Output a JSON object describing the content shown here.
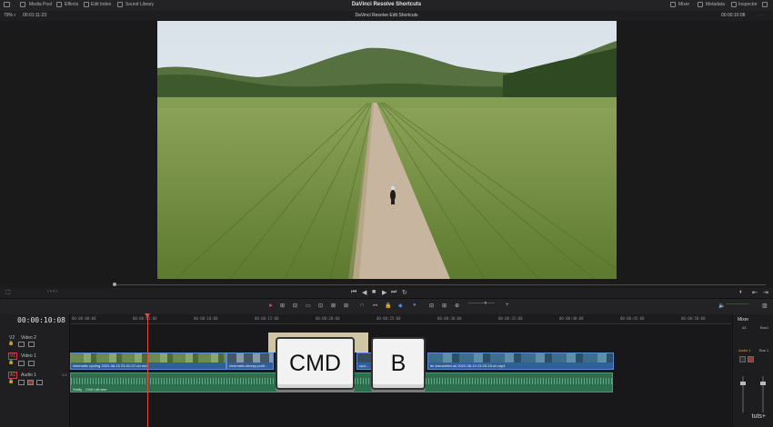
{
  "topbar": {
    "media_pool": "Media Pool",
    "effects": "Effects",
    "edit_index": "Edit Index",
    "sound_library": "Sound Library",
    "app_title": "DaVinci Resolve Shortcuts",
    "mixer": "Mixer",
    "metadata": "Metadata",
    "inspector": "Inspector"
  },
  "subbar": {
    "zoom": "79%",
    "source_timecode": "00:01:11:23",
    "timeline_name": "DaVinci Resolve Edit Shortcuts",
    "record_timecode": "00:00:10:08"
  },
  "timeline": {
    "timecode": "00:00:10:08",
    "ruler": [
      "00:00:00:00",
      "00:00:05:00",
      "00:00:10:00",
      "00:00:15:00",
      "00:00:20:00",
      "00:00:25:00",
      "00:00:30:00",
      "00:00:35:00",
      "00:00:40:00",
      "00:00:45:00",
      "00:00:50:00",
      "00:00:55:00",
      "00:01:00:00",
      "00:01:05:00",
      "00:01:10:00"
    ],
    "tracks": {
      "v2_id": "V2",
      "v2_name": "Video 2",
      "v1_id": "V1",
      "v1_name": "Video 1",
      "a1_id": "A1",
      "a1_name": "Audio 1",
      "a1_level": "2.0"
    },
    "clips": {
      "clip1": "cinematic cycling 2022-08-19 23-01-07-uh.mov",
      "clip2": "cinematic-steepy-profi...",
      "clip3": "cycl...",
      "clip4": "ler-kreuzfahrt-uk 2022-08-19 23-03-15-uh.mp4",
      "audio": "Stuffy - Chill Loft.wav"
    }
  },
  "mixer_panel": {
    "title": "Mixer",
    "a1": "A1",
    "bus1": "Bus1",
    "audio1": "Audio 1",
    "bus1b": "Bus 1"
  },
  "shortcut": {
    "key1": "CMD",
    "key2": "B"
  },
  "watermark": "tuts+",
  "colors": {
    "video_clip": "#2f5f9a",
    "audio_clip": "#2c6e4e",
    "playhead": "#e0493e"
  }
}
